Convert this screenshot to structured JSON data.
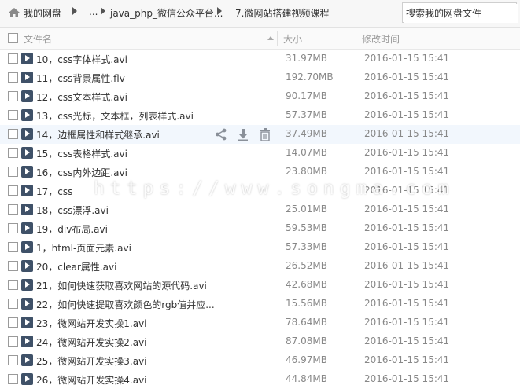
{
  "breadcrumb": {
    "items": [
      "我的网盘",
      "...",
      "java_php_微信公众平台...",
      "7.微网站搭建视频课程"
    ]
  },
  "search": {
    "placeholder": "搜索我的网盘文件"
  },
  "header": {
    "name": "文件名",
    "size": "大小",
    "modified": "修改时间"
  },
  "files": [
    {
      "name": "10，css字体样式.avi",
      "size": "31.97MB",
      "date": "2016-01-15 15:41"
    },
    {
      "name": "11，css背景属性.flv",
      "size": "192.70MB",
      "date": "2016-01-15 15:41"
    },
    {
      "name": "12，css文本样式.avi",
      "size": "90.17MB",
      "date": "2016-01-15 15:41"
    },
    {
      "name": "13，css光标，文本框，列表样式.avi",
      "size": "57.37MB",
      "date": "2016-01-15 15:41"
    },
    {
      "name": "14，边框属性和样式继承.avi",
      "size": "37.49MB",
      "date": "2016-01-15 15:41"
    },
    {
      "name": "15，css表格样式.avi",
      "size": "14.07MB",
      "date": "2016-01-15 15:41"
    },
    {
      "name": "16，css内外边距.avi",
      "size": "23.80MB",
      "date": "2016-01-15 15:41"
    },
    {
      "name": "17，css",
      "size": "",
      "date": "2016-01-15 15:41"
    },
    {
      "name": "18，css漂浮.avi",
      "size": "25.01MB",
      "date": "2016-01-15 15:41"
    },
    {
      "name": "19，div布局.avi",
      "size": "59.53MB",
      "date": "2016-01-15 15:41"
    },
    {
      "name": "1，html-页面元素.avi",
      "size": "57.33MB",
      "date": "2016-01-15 15:41"
    },
    {
      "name": "20，clear属性.avi",
      "size": "26.52MB",
      "date": "2016-01-15 15:41"
    },
    {
      "name": "21，如何快速获取喜欢网站的源代码.avi",
      "size": "42.68MB",
      "date": "2016-01-15 15:41"
    },
    {
      "name": "22，如何快速提取喜欢颜色的rgb值并应...",
      "size": "15.56MB",
      "date": "2016-01-15 15:41"
    },
    {
      "name": "23，微网站开发实操1.avi",
      "size": "78.64MB",
      "date": "2016-01-15 15:41"
    },
    {
      "name": "24，微网站开发实操2.avi",
      "size": "87.08MB",
      "date": "2016-01-15 15:41"
    },
    {
      "name": "25，微网站开发实操3.avi",
      "size": "46.97MB",
      "date": "2016-01-15 15:41"
    },
    {
      "name": "26，微网站开发实操4.avi",
      "size": "44.84MB",
      "date": "2016-01-15 15:41"
    }
  ],
  "hovered_row": 4,
  "row_actions": [
    "share-icon",
    "download-icon",
    "delete-icon"
  ],
  "watermark": "https://www.songma.com",
  "colors": {
    "file_icon": "#3f5168",
    "hover_row": "#f2f7fd",
    "muted_text": "#888888"
  }
}
